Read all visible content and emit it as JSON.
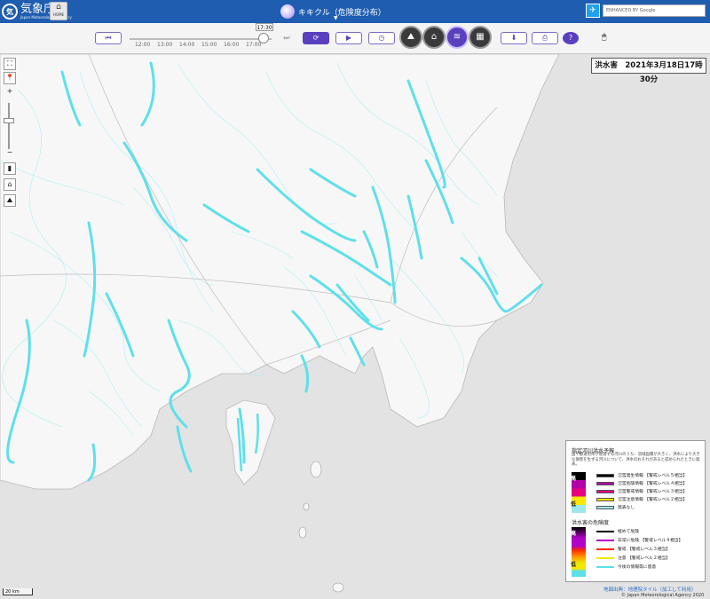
{
  "header": {
    "agency_mark": "気",
    "agency_name": "気象庁",
    "agency_sub": "Japan Meteorological Agency",
    "home_label": "HOME",
    "app_title": "キキクル（危険度分布）",
    "twitter_icon": "twitter-icon",
    "search_placeholder": "ENHANCED BY Google"
  },
  "toolbar": {
    "time_bubble": "17:30",
    "ticks": [
      "12:00",
      "13:00",
      "14:00",
      "15:00",
      "16:00",
      "17:00"
    ],
    "icons": {
      "first": "⏮",
      "last": "⏭",
      "latest": "⟳",
      "play": "▶",
      "speed": "◷",
      "download": "⬇",
      "print": "⎙",
      "help": "?",
      "mode_landslide": "⛰",
      "mode_inundation": "⌂",
      "mode_flood": "≋",
      "mode_map": "▦",
      "mouse": "🖱"
    }
  },
  "map": {
    "date_label": "洪水害　2021年3月18日17時30分",
    "scale_label": "20 km",
    "attribution_link": "地図出典：地理院タイル（加工して利用）",
    "copyright": "© Japan Meteorological Agency 2020",
    "controls": [
      "⛶",
      "📍",
      "+",
      "−",
      "▮",
      "⌂",
      "⛰"
    ]
  },
  "legend": {
    "title": "指定河川洪水予報",
    "note": "国や都道府県が管理する河川のうち、流域面積が大きく、洪水により大きな損害を生ずる河川について、洪水のおそれがあると認められたときに発表。",
    "bar1_high": "高",
    "bar1_low": "低",
    "bar1": [
      {
        "color": "#000000",
        "label": "氾濫発生情報 【警戒レベル５相当】"
      },
      {
        "color": "#b100a8",
        "label": "氾濫危険情報 【警戒レベル４相当】"
      },
      {
        "color": "#e6007f",
        "label": "氾濫警戒情報 【警戒レベル３相当】"
      },
      {
        "color": "#ffe700",
        "label": "氾濫注意情報 【警戒レベル２相当】"
      },
      {
        "color": "#9fe7ed",
        "label": "発表なし"
      }
    ],
    "title2": "洪水害の危険度",
    "bar2_high": "高",
    "bar2_low": "低",
    "bar2": [
      {
        "color": "#000000",
        "label": "極めて危険"
      },
      {
        "color": "#b100c8",
        "label": "非常に危険 【警戒レベル４相当】"
      },
      {
        "color": "#ff2800",
        "label": "警戒 【警戒レベル３相当】"
      },
      {
        "color": "#f2e700",
        "label": "注意 【警戒レベル２相当】"
      },
      {
        "color": "#5ee0ea",
        "label": "今後の情報等に留意"
      }
    ]
  },
  "colors": {
    "header_bg": "#1e5db0",
    "accent": "#5a3fbf",
    "river": "#5ee0ea",
    "sea": "#e3e3e3"
  }
}
